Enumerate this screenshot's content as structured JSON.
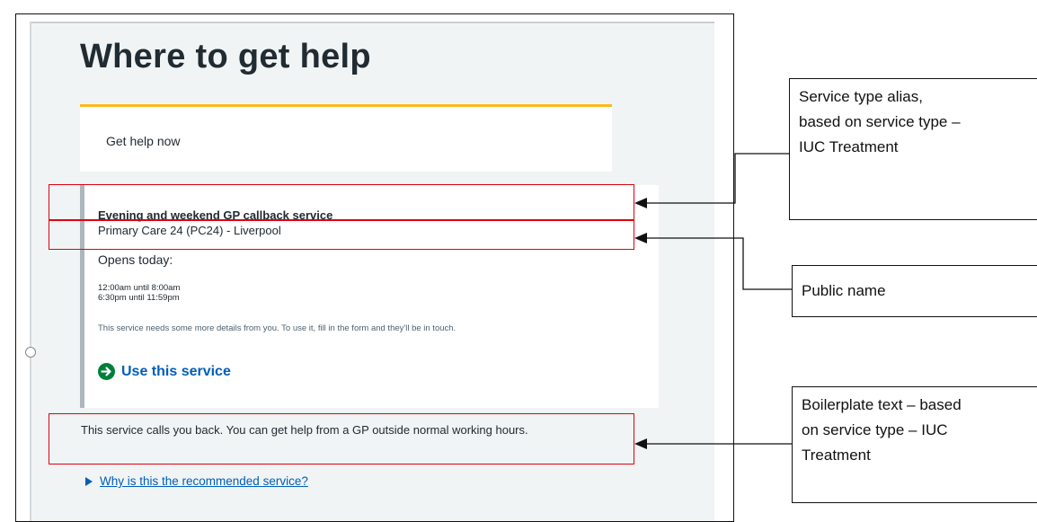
{
  "screenshot": {
    "title": "Where to get help",
    "help_card": {
      "text": "Get help now"
    },
    "service": {
      "alias": "Evening and weekend GP callback service",
      "public_name": "Primary Care 24 (PC24) - Liverpool",
      "opens_label": "Opens today:",
      "hours": [
        "12:00am until 8:00am",
        "6:30pm until 11:59pm"
      ],
      "details": "This service needs some more details from you. To use it, fill in the form and they'll be in touch.",
      "use_link": "Use this service"
    },
    "boilerplate": "This service calls you back. You can get help from a GP outside normal working hours.",
    "why_link": "Why is this the recommended service?"
  },
  "annotations": {
    "service_type_alias": [
      "Service type alias,",
      "based on service type  –",
      "IUC Treatment"
    ],
    "public_name": "Public name",
    "boilerplate": [
      "Boilerplate text – based",
      "on service type  – IUC",
      "Treatment"
    ]
  },
  "colors": {
    "highlight": "#e0000f",
    "nhs_blue": "#005eb8",
    "nhs_green": "#007f3b",
    "warm_yellow": "#ffb81c"
  }
}
